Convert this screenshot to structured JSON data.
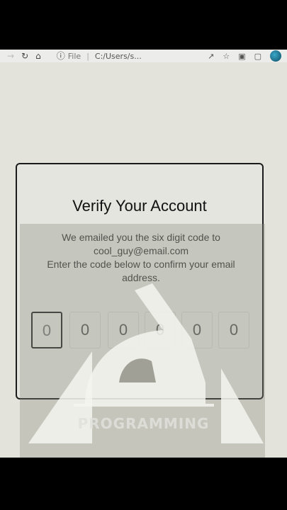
{
  "browser": {
    "file_label": "File",
    "url": "C:/Users/s..."
  },
  "card": {
    "title": "Verify Your Account",
    "line1": "We emailed you the six digit code to",
    "email": "cool_guy@email.com",
    "line2": "Enter the code below to confirm your email address."
  },
  "code_digits": [
    "0",
    "0",
    "0",
    "0",
    "0",
    "0"
  ],
  "watermark": {
    "logo_text": "PROGRAMMING"
  },
  "icons": {
    "back": "arrow-left-icon",
    "reload": "reload-icon",
    "home": "home-icon",
    "info": "info-icon",
    "share": "share-icon",
    "bookmark": "star-icon",
    "extensions": "puzzle-icon",
    "window": "window-icon",
    "profile": "avatar-icon"
  }
}
